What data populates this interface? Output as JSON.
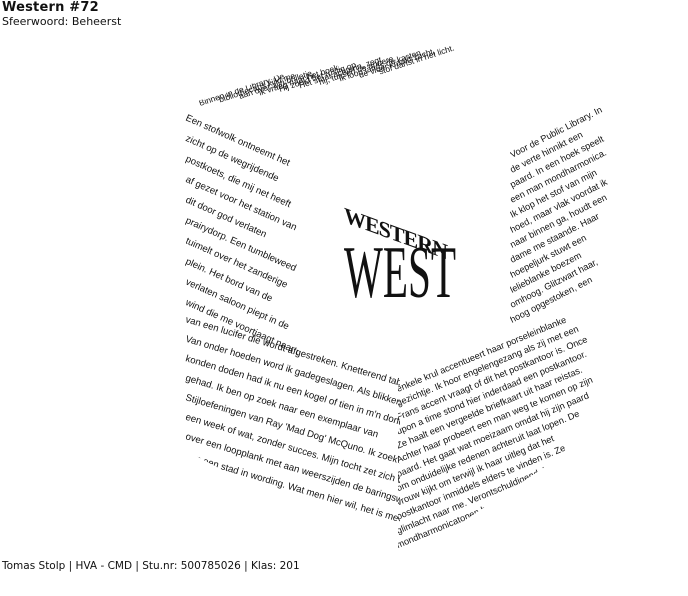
{
  "header": {
    "title": "Western #72",
    "subtitle": "Sfeerwoord: Beheerst"
  },
  "logo": {
    "word_top": "WESTERN",
    "word_main": "WEST"
  },
  "faces": {
    "left": [
      "Een stofwolk ontneemt het",
      "zicht op de wegrijdende",
      "postkoets, die mij net heeft",
      "af gezet voor het station van",
      "dit door god verlaten",
      "prairydorp. Een tumbleweed",
      "tuimelt over het zanderige",
      "plein. Het bord van de",
      "verlaten saloon piept in de",
      "wind die me voortjaagt naar de",
      "van een lucifer die wordt afgestreken. Knetterend tabak",
      "Van onder hoeden word ik gadegeslagen. Als blikken",
      "konden doden had ik nu een kogel of tien in m'n donder.",
      "gehad. Ik ben op zoek naar een exemplaar van",
      "Stijloefeningen van Ray 'Mad Dog' McQuno. Ik zoek het al",
      "een week of wat, zonder succes. Mijn tocht zet zich voort",
      "over een loopplank met aan weerszijden de baringsweeën",
      "van een stad in wording. Wat men hier wil, het is me een"
    ],
    "right": [
      "Voor de Public Library. In",
      "de verte hinnikt een",
      "paard. In een hoek speelt",
      "een man mondharmonica.",
      "Ik klop het stof van mijn",
      "hoed, maar vlak voordat ik",
      "naar binnen ga, houdt een",
      "dame me staande. Haar",
      "hoepeljurk stuwt een",
      "lelieblanke boezem",
      "omhoog. Glitzwart haar,",
      "hoog opgestoken, een",
      "enkele krul accentueert haar porseleinblanke",
      "gezichtje. Ik hoor engelengezang als zij met een",
      "Frans accent vraagt of dit het postkantoor is. Once",
      "upon a time stond hier inderdaad een postkantoor.",
      "Ze haalt een vergeelde briefkaart uit haar reistas.",
      "Achter haar probeert een man weg te komen op zijn",
      "paard. Het gaat wat moeizaam omdat hij zijn paard",
      "om onduidelijke redenen achteruit laat lopen. De",
      "vrouw kijkt om terwijl ik haar uitleg dat het",
      "postkantoor inmiddels elders te vinden is. Ze",
      "glimlacht naar me. Verontschuldigend. Lang gerekte",
      "mondharmonicatonen begeleiden het wegrennen van"
    ],
    "top": [
      "Binnen in de Library. De",
      "bibliothecaris kijkt me",
      "aan over zijn brilletje,",
      "ik vraag naar het boek.",
      "Hij zoekt het rustig op.",
      "Het staat achterin, zegt",
      "hij, tussen de andere.",
      "Ik loop langs de kasten,",
      "de vloer kraakt zacht,",
      "stof danst in het licht."
    ]
  },
  "footer": {
    "credit": "Tomas Stolp | HVA - CMD | Stu.nr: 500785026 | Klas: 201"
  },
  "colors": {
    "ink": "#111111",
    "paper": "#ffffff"
  }
}
